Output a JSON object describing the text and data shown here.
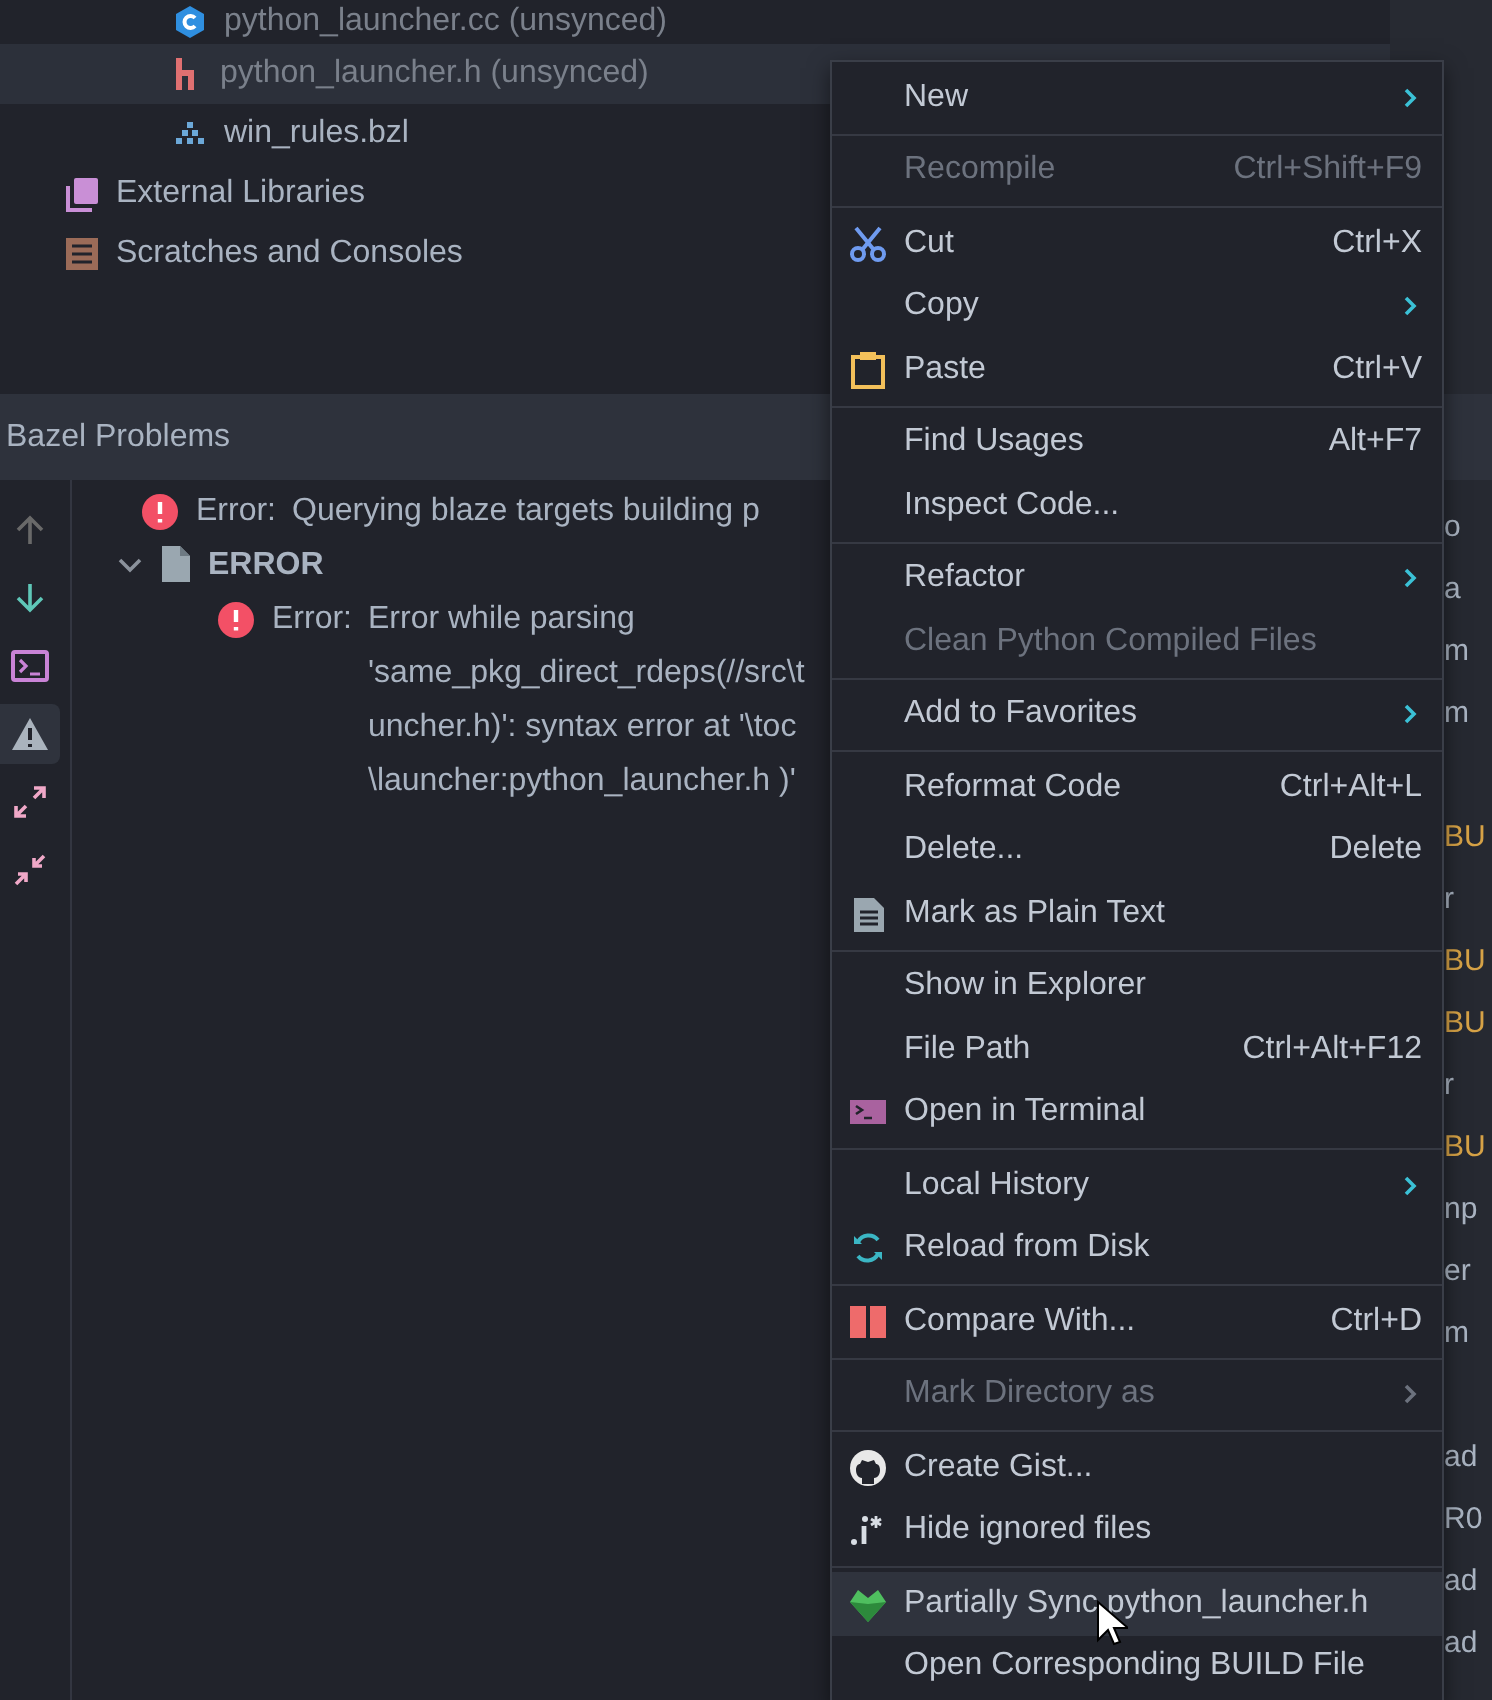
{
  "project_tree": [
    {
      "label": "python_launcher.cc (unsynced)",
      "kind": "file",
      "selected": false,
      "dim": true
    },
    {
      "label": "python_launcher.h (unsynced)",
      "kind": "file",
      "selected": true,
      "dim": true
    },
    {
      "label": "win_rules.bzl",
      "kind": "file",
      "selected": false,
      "dim": false
    },
    {
      "label": "External Libraries",
      "kind": "root",
      "selected": false,
      "dim": false
    },
    {
      "label": "Scratches and Consoles",
      "kind": "root",
      "selected": false,
      "dim": false
    }
  ],
  "panel": {
    "title": "Bazel Problems",
    "toolbar": [
      {
        "selected": false,
        "disabled": true
      },
      {
        "selected": false,
        "disabled": false
      },
      {
        "selected": false,
        "disabled": false
      },
      {
        "selected": true,
        "disabled": false
      },
      {
        "selected": false,
        "disabled": false
      },
      {
        "selected": false,
        "disabled": false
      }
    ],
    "problems": [
      {
        "kind": "error",
        "prefix": "Error:",
        "lines": [
          "Querying blaze targets building p"
        ]
      },
      {
        "kind": "file",
        "label": "ERROR",
        "expanded": true,
        "children": [
          {
            "kind": "error",
            "prefix": "Error:",
            "lines": [
              "Error while parsing",
              "'same_pkg_direct_rdeps(//src\\t",
              "uncher.h)': syntax error at '\\toc",
              "\\launcher:python_launcher.h )'"
            ]
          }
        ]
      }
    ]
  },
  "background_fragments": [
    {
      "text": "o",
      "kind": "plain"
    },
    {
      "text": "a",
      "kind": "plain"
    },
    {
      "text": "m",
      "kind": "plain"
    },
    {
      "text": "m",
      "kind": "plain"
    },
    {
      "kind": "blank"
    },
    {
      "text": "BU",
      "kind": "keyword"
    },
    {
      "text": "r",
      "kind": "plain"
    },
    {
      "text": "BU",
      "kind": "keyword"
    },
    {
      "text": "BU",
      "kind": "keyword"
    },
    {
      "text": "r",
      "kind": "plain"
    },
    {
      "text": "BU",
      "kind": "keyword"
    },
    {
      "text": "np",
      "kind": "plain"
    },
    {
      "text": "er",
      "kind": "plain"
    },
    {
      "text": "m",
      "kind": "plain"
    },
    {
      "kind": "blank"
    },
    {
      "text": "ad",
      "kind": "plain"
    },
    {
      "text": "R0",
      "kind": "plain"
    },
    {
      "text": "ad",
      "kind": "plain"
    },
    {
      "text": "ad",
      "kind": "plain"
    }
  ],
  "context_menu": [
    [
      {
        "label": "New",
        "submenu": true,
        "disabled": false,
        "selected": false
      }
    ],
    [
      {
        "label": "Recompile",
        "shortcut": "Ctrl+Shift+F9",
        "submenu": false,
        "disabled": true,
        "selected": false
      }
    ],
    [
      {
        "label": "Cut",
        "shortcut": "Ctrl+X",
        "submenu": false,
        "disabled": false,
        "selected": false
      },
      {
        "label": "Copy",
        "submenu": true,
        "disabled": false,
        "selected": false
      },
      {
        "label": "Paste",
        "shortcut": "Ctrl+V",
        "submenu": false,
        "disabled": false,
        "selected": false
      }
    ],
    [
      {
        "label": "Find Usages",
        "shortcut": "Alt+F7",
        "submenu": false,
        "disabled": false,
        "selected": false
      },
      {
        "label": "Inspect Code...",
        "submenu": false,
        "disabled": false,
        "selected": false
      }
    ],
    [
      {
        "label": "Refactor",
        "submenu": true,
        "disabled": false,
        "selected": false
      },
      {
        "label": "Clean Python Compiled Files",
        "submenu": false,
        "disabled": true,
        "selected": false
      }
    ],
    [
      {
        "label": "Add to Favorites",
        "submenu": true,
        "disabled": false,
        "selected": false
      }
    ],
    [
      {
        "label": "Reformat Code",
        "shortcut": "Ctrl+Alt+L",
        "submenu": false,
        "disabled": false,
        "selected": false
      },
      {
        "label": "Delete...",
        "shortcut": "Delete",
        "submenu": false,
        "disabled": false,
        "selected": false
      },
      {
        "label": "Mark as Plain Text",
        "submenu": false,
        "disabled": false,
        "selected": false
      }
    ],
    [
      {
        "label": "Show in Explorer",
        "submenu": false,
        "disabled": false,
        "selected": false
      },
      {
        "label": "File Path",
        "shortcut": "Ctrl+Alt+F12",
        "submenu": false,
        "disabled": false,
        "selected": false
      },
      {
        "label": "Open in Terminal",
        "submenu": false,
        "disabled": false,
        "selected": false
      }
    ],
    [
      {
        "label": "Local History",
        "submenu": true,
        "disabled": false,
        "selected": false
      },
      {
        "label": "Reload from Disk",
        "submenu": false,
        "disabled": false,
        "selected": false
      }
    ],
    [
      {
        "label": "Compare With...",
        "shortcut": "Ctrl+D",
        "submenu": false,
        "disabled": false,
        "selected": false
      }
    ],
    [
      {
        "label": "Mark Directory as",
        "submenu": true,
        "disabled": true,
        "selected": false
      }
    ],
    [
      {
        "label": "Create Gist...",
        "submenu": false,
        "disabled": false,
        "selected": false
      },
      {
        "label": "Hide ignored files",
        "submenu": false,
        "disabled": false,
        "selected": false
      }
    ],
    [
      {
        "label": "Partially Sync python_launcher.h",
        "submenu": false,
        "disabled": false,
        "selected": true
      },
      {
        "label": "Open Corresponding BUILD File",
        "submenu": false,
        "disabled": false,
        "selected": false
      }
    ]
  ]
}
